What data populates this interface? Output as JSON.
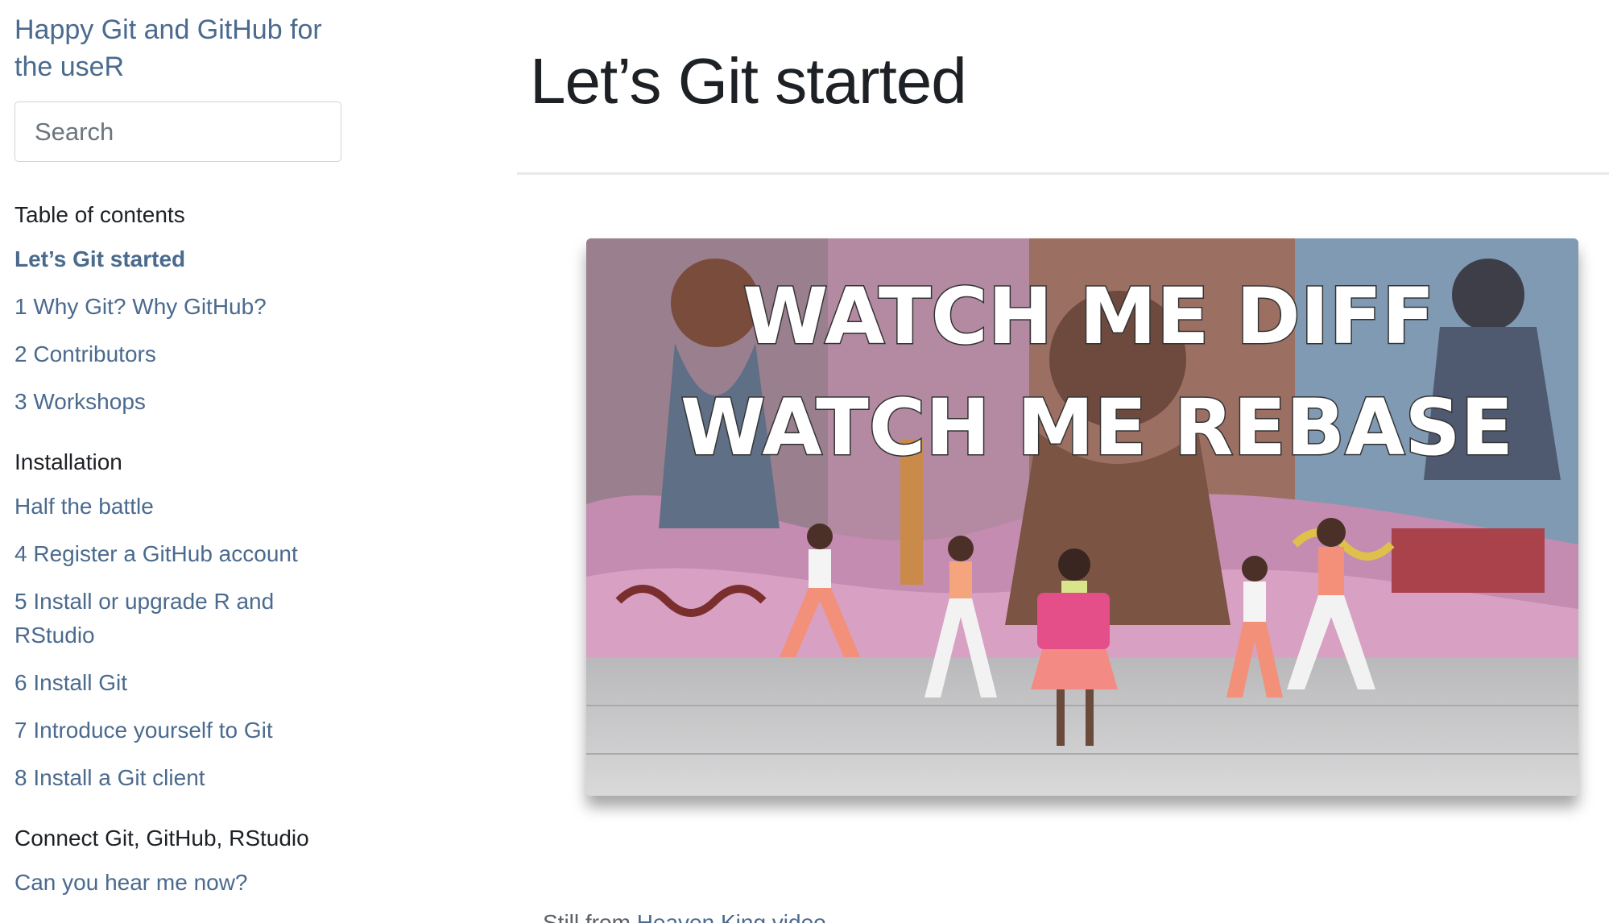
{
  "sidebar": {
    "site_title": "Happy Git and GitHub for the useR",
    "search_placeholder": "Search",
    "toc_heading": "Table of contents",
    "toc_items": [
      {
        "label": "Let’s Git started"
      },
      {
        "label": "1 Why Git? Why GitHub?"
      },
      {
        "label": "2 Contributors"
      },
      {
        "label": "3 Workshops"
      }
    ],
    "section_installation": "Installation",
    "installation_items": [
      {
        "label": "Half the battle"
      },
      {
        "label": "4 Register a GitHub account"
      },
      {
        "label": "5 Install or upgrade R and RStudio"
      },
      {
        "label": "6 Install Git"
      },
      {
        "label": "7 Introduce yourself to Git"
      },
      {
        "label": "8 Install a Git client"
      }
    ],
    "section_connect": "Connect Git, GitHub, RStudio",
    "connect_items": [
      {
        "label": "Can you hear me now?"
      }
    ]
  },
  "main": {
    "page_title": "Let’s Git started",
    "image": {
      "line1": "WATCH ME DIFF",
      "line2": "WATCH ME REBASE"
    },
    "caption_prefix": "Still from ",
    "caption_link": "Heaven King video"
  },
  "colors": {
    "link": "#4a6a8e",
    "text": "#1d2125",
    "muted": "#5b6066"
  }
}
